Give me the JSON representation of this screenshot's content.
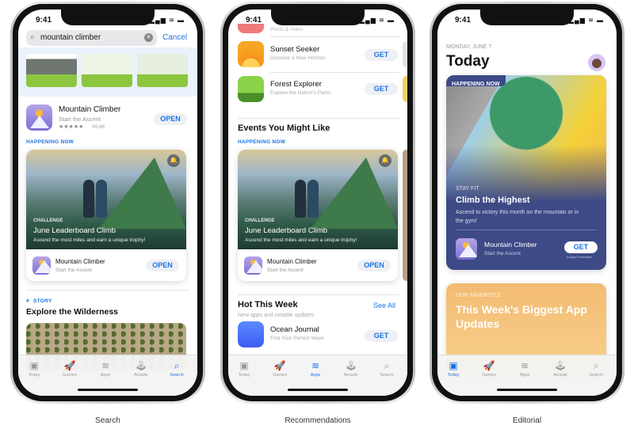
{
  "status": {
    "time": "9:41",
    "icons": "▂▄▆ ≋ ▬"
  },
  "search_screen": {
    "caption": "Search",
    "search_query": "mountain climber",
    "cancel_label": "Cancel",
    "app": {
      "name": "Mountain Climber",
      "subtitle": "Start the Ascent",
      "stars": "★★★★★",
      "rating_count": "99.8K",
      "action": "OPEN"
    },
    "happening_now": "HAPPENING NOW",
    "event": {
      "kicker": "CHALLENGE",
      "title": "June Leaderboard Climb",
      "description": "Ascend the most miles and earn a unique trophy!",
      "app_name": "Mountain Climber",
      "app_subtitle": "Start the Ascent",
      "action": "OPEN"
    },
    "story_kicker": "STORY",
    "story_title": "Explore the Wilderness",
    "active_tab": "Search"
  },
  "recommendations_screen": {
    "caption": "Recommendations",
    "partial_row": "Photo & Video",
    "apps": [
      {
        "name": "Sunset Seeker",
        "subtitle": "Discover a New Horizon",
        "action": "GET"
      },
      {
        "name": "Forest Explorer",
        "subtitle": "Explore the Nation's Parks",
        "action": "GET"
      }
    ],
    "events_title": "Events You Might Like",
    "happening_now": "HAPPENING NOW",
    "event": {
      "kicker": "CHALLENGE",
      "title": "June Leaderboard Climb",
      "description": "Ascend the most miles and earn a unique trophy!",
      "app_name": "Mountain Climber",
      "app_subtitle": "Start the Ascent",
      "action": "OPEN"
    },
    "hot_title": "Hot This Week",
    "hot_subtitle": "New apps and notable updates",
    "see_all": "See All",
    "hot_app": {
      "name": "Ocean Journal",
      "subtitle": "Find Your Perfect Wave",
      "action": "GET"
    },
    "active_tab": "Apps"
  },
  "editorial_screen": {
    "caption": "Editorial",
    "date": "MONDAY, JUNE 7",
    "title": "Today",
    "feature": {
      "badge": "HAPPENING NOW",
      "kicker": "STAY FIT",
      "title": "Climb the Highest",
      "description": "Ascend to victory this month on the mountain or in the gym!",
      "app_name": "Mountain Climber",
      "app_subtitle": "Start the Ascent",
      "action": "GET",
      "note": "In-App Purchases"
    },
    "favorites": {
      "kicker": "OUR FAVORITES",
      "title": "This Week's Biggest App Updates"
    },
    "active_tab": "Today"
  },
  "tabs": [
    {
      "label": "Today",
      "icon": "today-icon",
      "glyph": "▣"
    },
    {
      "label": "Games",
      "icon": "rocket-icon",
      "glyph": "🚀"
    },
    {
      "label": "Apps",
      "icon": "layers-icon",
      "glyph": "≋"
    },
    {
      "label": "Arcade",
      "icon": "joystick-icon",
      "glyph": "🕹"
    },
    {
      "label": "Search",
      "icon": "search-icon",
      "glyph": "⌕"
    }
  ],
  "colors": {
    "accent": "#1a73e8",
    "feature_card": "#3d4a86",
    "favorites_card": "#f3c178"
  }
}
